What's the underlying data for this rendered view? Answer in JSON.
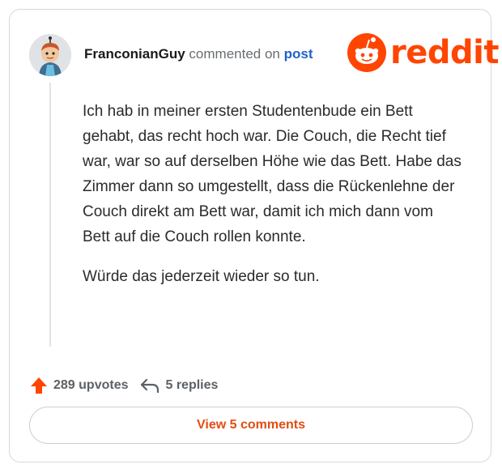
{
  "comment": {
    "username": "FranconianGuy",
    "action_text": "commented on",
    "post_link": "post",
    "body": [
      "Ich hab in meiner ersten Studentenbude ein Bett gehabt, das recht hoch war. Die Couch, die Recht tief war, war so auf derselben Höhe wie das Bett. Habe das Zimmer dann so umgestellt, dass die Rückenlehne der Couch direkt am Bett war, damit ich mich dann vom Bett auf die Couch rollen konnte.",
      "Würde das jederzeit wieder so tun."
    ]
  },
  "brand": {
    "wordmark": "reddit",
    "color": "#ff4500"
  },
  "stats": {
    "upvotes": "289 upvotes",
    "replies": "5 replies"
  },
  "footer": {
    "view_comments_label": "View 5 comments"
  },
  "icons": {
    "upvote": "upvote-arrow-icon",
    "reply": "reply-arrow-icon",
    "logo": "reddit-snoo-icon"
  },
  "colors": {
    "accent": "#ff4500",
    "link": "#1f62c7",
    "button_text": "#e34d12"
  }
}
